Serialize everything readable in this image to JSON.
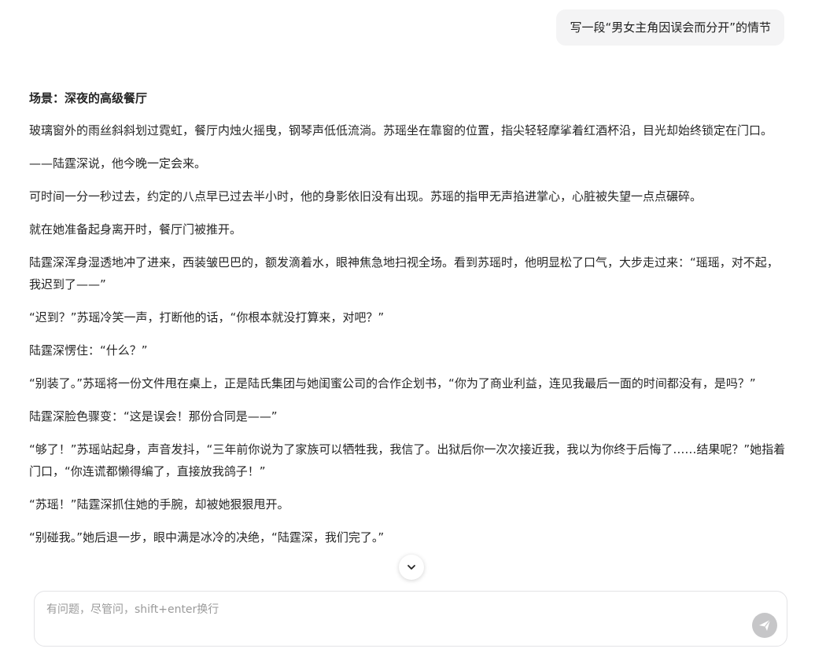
{
  "user_message": "写一段“男女主角因误会而分开”的情节",
  "answer": {
    "heading": "场景：深夜的高级餐厅",
    "paragraphs": [
      "玻璃窗外的雨丝斜斜划过霓虹，餐厅内烛火摇曳，钢琴声低低流淌。苏瑶坐在靠窗的位置，指尖轻轻摩挲着红酒杯沿，目光却始终锁定在门口。",
      "——陆霆深说，他今晚一定会来。",
      "可时间一分一秒过去，约定的八点早已过去半小时，他的身影依旧没有出现。苏瑶的指甲无声掐进掌心，心脏被失望一点点碾碎。",
      "就在她准备起身离开时，餐厅门被推开。",
      "陆霆深浑身湿透地冲了进来，西装皱巴巴的，额发滴着水，眼神焦急地扫视全场。看到苏瑶时，他明显松了口气，大步走过来：“瑶瑶，对不起，我迟到了——”",
      "“迟到？”苏瑶冷笑一声，打断他的话，“你根本就没打算来，对吧？”",
      "陆霆深愣住：“什么？”",
      "“别装了。”苏瑶将一份文件甩在桌上，正是陆氏集团与她闺蜜公司的合作企划书，“你为了商业利益，连见我最后一面的时间都没有，是吗？”",
      "陆霆深脸色骤变：“这是误会！那份合同是——”",
      "“够了！”苏瑶站起身，声音发抖，“三年前你说为了家族可以牺牲我，我信了。出狱后你一次次接近我，我以为你终于后悔了……结果呢？”她指着门口，“你连谎都懒得编了，直接放我鸽子！”",
      "“苏瑶！”陆霆深抓住她的手腕，却被她狠狠甩开。",
      "“别碰我。”她后退一步，眼中满是冰冷的决绝，“陆霆深，我们完了。”"
    ]
  },
  "input": {
    "placeholder": "有问题，尽管问，shift+enter换行",
    "value": ""
  },
  "icons": {
    "scroll_down": "chevron-down-icon",
    "send": "send-arrow-icon"
  },
  "colors": {
    "bubble_bg": "#f4f4f5",
    "send_disabled": "#c6c6c8"
  }
}
